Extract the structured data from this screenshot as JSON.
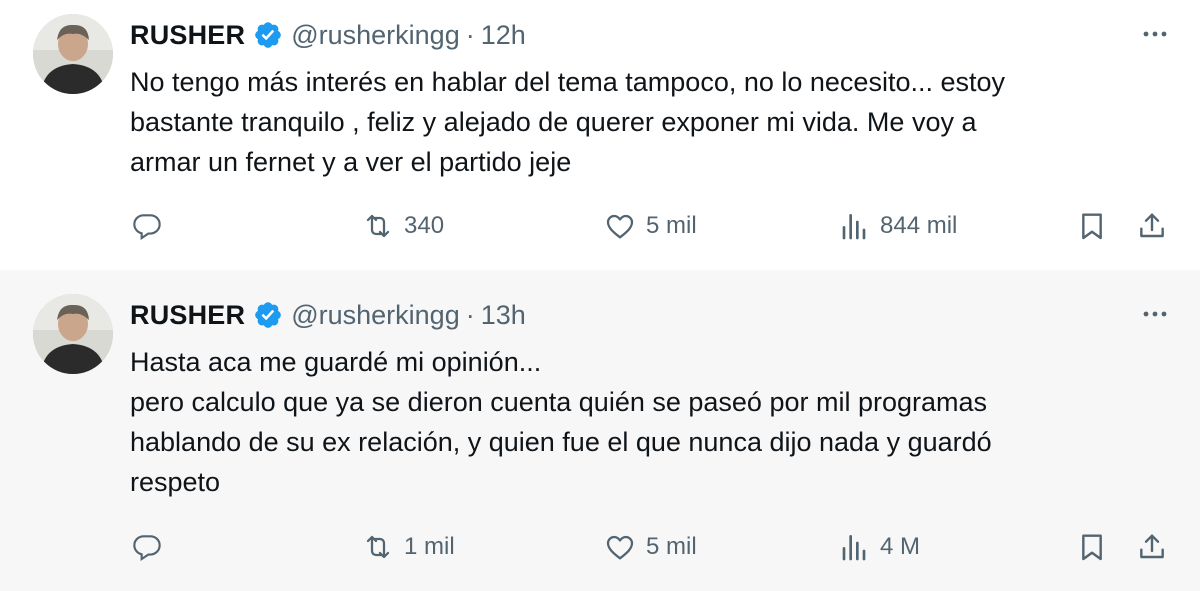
{
  "tweets": [
    {
      "author": {
        "name": "RUSHER",
        "handle": "@rusherkingg",
        "verified_icon": "verified-badge-icon",
        "avatar": "user-avatar"
      },
      "separator": "·",
      "time": "12h",
      "text": "No tengo más interés en hablar del tema tampoco, no lo necesito... estoy\nbastante tranquilo , feliz y alejado de querer exponer mi vida. Me voy a\narmar un fernet y a ver el partido jeje",
      "actions": {
        "reply_count": "",
        "retweet_count": "340",
        "like_count": "5 mil",
        "view_count": "844 mil"
      }
    },
    {
      "author": {
        "name": "RUSHER",
        "handle": "@rusherkingg",
        "verified_icon": "verified-badge-icon",
        "avatar": "user-avatar"
      },
      "separator": "·",
      "time": "13h",
      "text": "Hasta aca me guardé mi opinión...\npero calculo que ya se dieron  cuenta quién se paseó por mil programas\nhablando de su ex relación, y quien fue el que nunca dijo nada y guardó\nrespeto",
      "actions": {
        "reply_count": "",
        "retweet_count": "1 mil",
        "like_count": "5 mil",
        "view_count": "4 M"
      }
    }
  ],
  "colors": {
    "verified_blue": "#1d9bf0",
    "secondary_text": "#536471",
    "primary_text": "#0f1419",
    "hover_background": "#f7f7f7"
  },
  "icons": [
    "more-icon",
    "reply-icon",
    "retweet-icon",
    "like-icon",
    "views-icon",
    "bookmark-icon",
    "share-icon"
  ]
}
